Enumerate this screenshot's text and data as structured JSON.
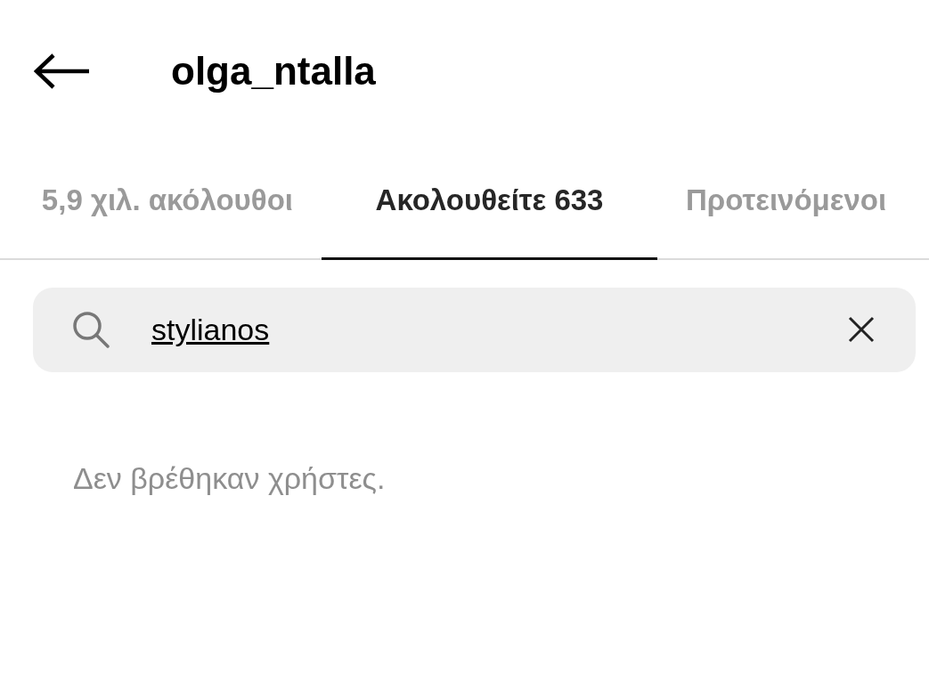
{
  "header": {
    "title": "olga_ntalla"
  },
  "tabs": [
    {
      "label": "5,9 χιλ. ακόλουθοι",
      "selected": false
    },
    {
      "label": "Ακολουθείτε 633",
      "selected": true
    },
    {
      "label": "Προτεινόμενοι",
      "selected": false
    }
  ],
  "search": {
    "value": "stylianos"
  },
  "empty_message": "Δεν βρέθηκαν χρήστες."
}
